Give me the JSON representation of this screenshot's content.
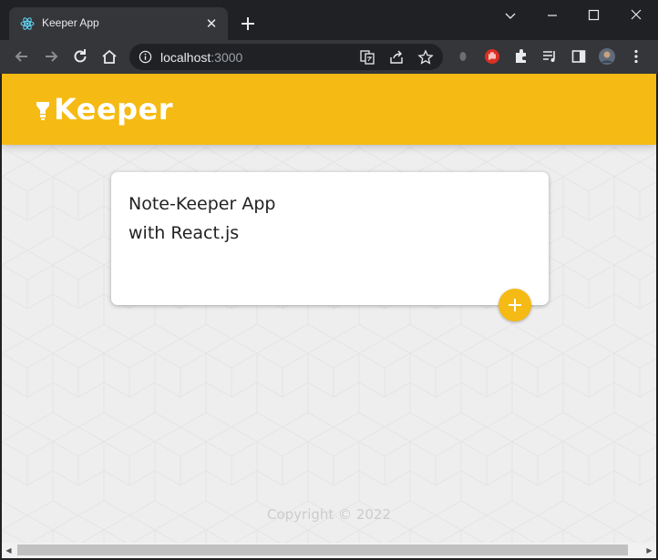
{
  "browser": {
    "tab": {
      "title": "Keeper App",
      "favicon": "react-logo-icon"
    },
    "url_host": "localhost",
    "url_port": ":3000",
    "colors": {
      "frame": "#202124",
      "toolbar": "#35363a",
      "text": "#e8eaed"
    }
  },
  "app": {
    "logo": "Keeper",
    "logo_icon": "lightbulb-icon",
    "note": {
      "line1": "Note-Keeper App",
      "line2": "with React.js"
    },
    "add_button_icon": "plus-icon",
    "footer": "Copyright © 2022",
    "colors": {
      "accent": "#f5ba13",
      "background": "#eeeeee",
      "card": "#ffffff"
    }
  }
}
